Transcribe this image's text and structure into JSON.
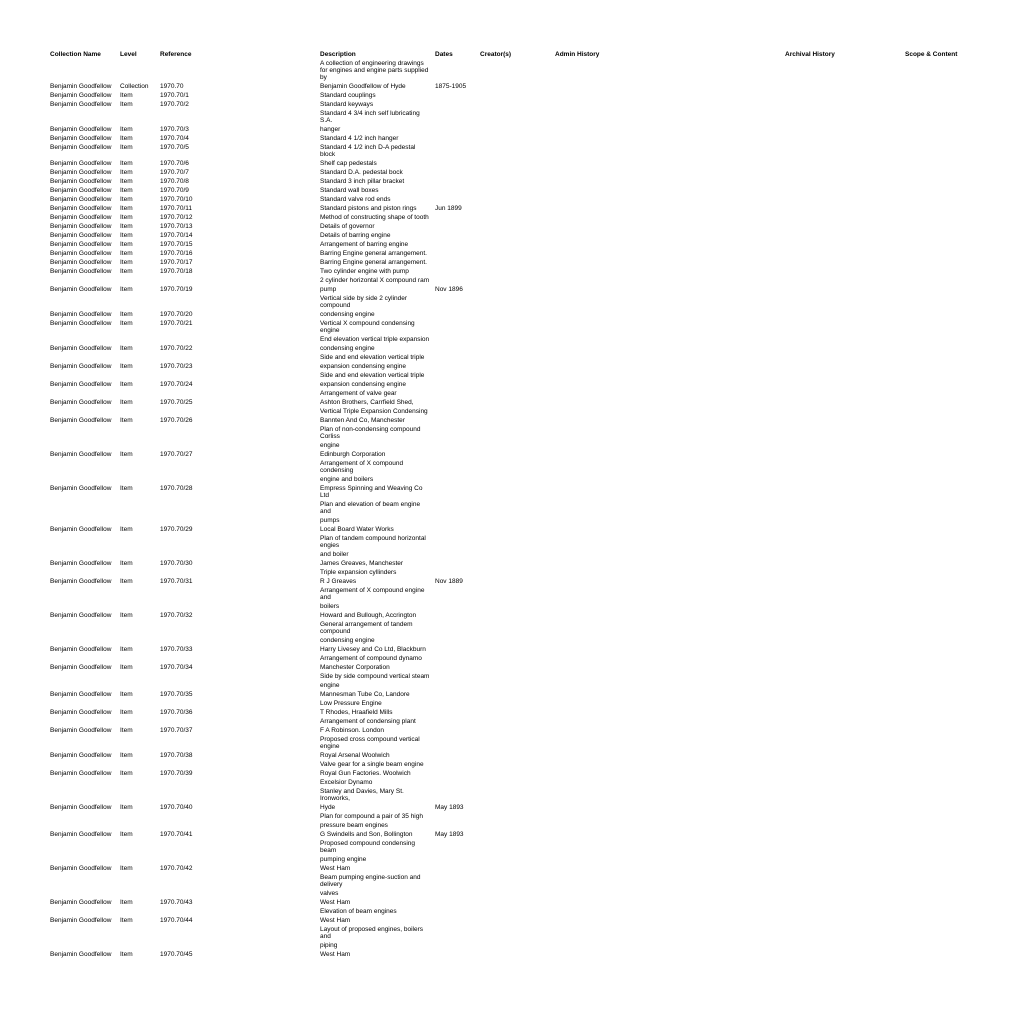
{
  "headers": {
    "collection": "Collection Name",
    "level": "Level",
    "reference": "Reference",
    "description": "Description",
    "dates": "Dates",
    "creator": "Creator(s)",
    "admin": "Admin History",
    "archival": "Archival History",
    "scope": "Scope & Content"
  },
  "rows": [
    {
      "collection": "",
      "level": "",
      "reference": "",
      "description": "A collection of engineering drawings for engines and engine parts supplied by",
      "dates": "",
      "creator": ""
    },
    {
      "collection": "Benjamin Goodfellow",
      "level": "Collection",
      "reference": "1970.70",
      "description": "Benjamin Goodfellow of Hyde",
      "dates": "1875-1905",
      "creator": ""
    },
    {
      "collection": "Benjamin Goodfellow",
      "level": "Item",
      "reference": "1970.70/1",
      "description": "Standard couplings",
      "dates": "",
      "creator": ""
    },
    {
      "collection": "Benjamin Goodfellow",
      "level": "Item",
      "reference": "1970.70/2",
      "description": "Standard keyways",
      "dates": "",
      "creator": ""
    },
    {
      "collection": "",
      "level": "",
      "reference": "",
      "description": "Standard 4 3/4 inch self lubricating S.A.",
      "dates": "",
      "creator": ""
    },
    {
      "collection": "Benjamin Goodfellow",
      "level": "Item",
      "reference": "1970.70/3",
      "description": "hanger",
      "dates": "",
      "creator": ""
    },
    {
      "collection": "Benjamin Goodfellow",
      "level": "Item",
      "reference": "1970.70/4",
      "description": "Standard 4 1/2 inch hanger",
      "dates": "",
      "creator": ""
    },
    {
      "collection": "Benjamin Goodfellow",
      "level": "Item",
      "reference": "1970.70/5",
      "description": "Standard 4 1/2 inch D-A pedestal block",
      "dates": "",
      "creator": ""
    },
    {
      "collection": "Benjamin Goodfellow",
      "level": "Item",
      "reference": "1970.70/6",
      "description": "Shelf cap pedestals",
      "dates": "",
      "creator": ""
    },
    {
      "collection": "Benjamin Goodfellow",
      "level": "Item",
      "reference": "1970.70/7",
      "description": "Standard D.A. pedestal bock",
      "dates": "",
      "creator": ""
    },
    {
      "collection": "Benjamin Goodfellow",
      "level": "Item",
      "reference": "1970.70/8",
      "description": "Standard 3 inch pillar bracket",
      "dates": "",
      "creator": ""
    },
    {
      "collection": "Benjamin Goodfellow",
      "level": "Item",
      "reference": "1970.70/9",
      "description": "Standard wall boxes",
      "dates": "",
      "creator": ""
    },
    {
      "collection": "Benjamin Goodfellow",
      "level": "Item",
      "reference": "1970.70/10",
      "description": "Standard valve rod ends",
      "dates": "",
      "creator": ""
    },
    {
      "collection": "Benjamin Goodfellow",
      "level": "Item",
      "reference": "1970.70/11",
      "description": "Standard pistons and piston rings",
      "dates": "Jun 1899",
      "creator": ""
    },
    {
      "collection": "Benjamin Goodfellow",
      "level": "Item",
      "reference": "1970.70/12",
      "description": "Method of constructing shape of tooth",
      "dates": "",
      "creator": ""
    },
    {
      "collection": "Benjamin Goodfellow",
      "level": "Item",
      "reference": "1970.70/13",
      "description": "Details of governor",
      "dates": "",
      "creator": ""
    },
    {
      "collection": "Benjamin Goodfellow",
      "level": "Item",
      "reference": "1970.70/14",
      "description": "Details of barring engine",
      "dates": "",
      "creator": ""
    },
    {
      "collection": "Benjamin Goodfellow",
      "level": "Item",
      "reference": "1970.70/15",
      "description": "Arrangement of barring engine",
      "dates": "",
      "creator": ""
    },
    {
      "collection": "Benjamin Goodfellow",
      "level": "Item",
      "reference": "1970.70/16",
      "description": "Barring Engine general arrangement.",
      "dates": "",
      "creator": ""
    },
    {
      "collection": "Benjamin Goodfellow",
      "level": "Item",
      "reference": "1970.70/17",
      "description": "Barring Engine general arrangement.",
      "dates": "",
      "creator": ""
    },
    {
      "collection": "Benjamin Goodfellow",
      "level": "Item",
      "reference": "1970.70/18",
      "description": "Two cylinder engine with pump",
      "dates": "",
      "creator": ""
    },
    {
      "collection": "",
      "level": "",
      "reference": "",
      "description": "2 cylinder horizontal X compound ram",
      "dates": "",
      "creator": ""
    },
    {
      "collection": "Benjamin Goodfellow",
      "level": "Item",
      "reference": "1970.70/19",
      "description": "pump",
      "dates": "Nov 1896",
      "creator": ""
    },
    {
      "collection": "",
      "level": "",
      "reference": "",
      "description": "Vertical side by side 2 cylinder compound",
      "dates": "",
      "creator": ""
    },
    {
      "collection": "Benjamin Goodfellow",
      "level": "Item",
      "reference": "1970.70/20",
      "description": "condensing engine",
      "dates": "",
      "creator": ""
    },
    {
      "collection": "Benjamin Goodfellow",
      "level": "Item",
      "reference": "1970.70/21",
      "description": "Vertical X compound condensing engine",
      "dates": "",
      "creator": ""
    },
    {
      "collection": "",
      "level": "",
      "reference": "",
      "description": "End elevation vertical triple expansion",
      "dates": "",
      "creator": ""
    },
    {
      "collection": "Benjamin Goodfellow",
      "level": "Item",
      "reference": "1970.70/22",
      "description": "condensing engine",
      "dates": "",
      "creator": ""
    },
    {
      "collection": "",
      "level": "",
      "reference": "",
      "description": "Side and end elevation vertical triple",
      "dates": "",
      "creator": ""
    },
    {
      "collection": "Benjamin Goodfellow",
      "level": "Item",
      "reference": "1970.70/23",
      "description": "expansion condensing engine",
      "dates": "",
      "creator": ""
    },
    {
      "collection": "",
      "level": "",
      "reference": "",
      "description": "Side and end elevation vertical triple",
      "dates": "",
      "creator": ""
    },
    {
      "collection": "Benjamin Goodfellow",
      "level": "Item",
      "reference": "1970.70/24",
      "description": "expansion condensing engine",
      "dates": "",
      "creator": ""
    },
    {
      "collection": "",
      "level": "",
      "reference": "",
      "description": "Arrangement of valve gear",
      "dates": "",
      "creator": ""
    },
    {
      "collection": "Benjamin Goodfellow",
      "level": "Item",
      "reference": "1970.70/25",
      "description": "Ashton Brothers, Carrfield Shed,",
      "dates": "",
      "creator": ""
    },
    {
      "collection": "",
      "level": "",
      "reference": "",
      "description": "Vertical Triple Expansion Condensing",
      "dates": "",
      "creator": ""
    },
    {
      "collection": "Benjamin Goodfellow",
      "level": "Item",
      "reference": "1970.70/26",
      "description": "Bannten And Co, Manchester",
      "dates": "",
      "creator": ""
    },
    {
      "collection": "",
      "level": "",
      "reference": "",
      "description": "Plan of non-condensing compound Corliss",
      "dates": "",
      "creator": ""
    },
    {
      "collection": "",
      "level": "",
      "reference": "",
      "description": "engine",
      "dates": "",
      "creator": ""
    },
    {
      "collection": "Benjamin Goodfellow",
      "level": "Item",
      "reference": "1970.70/27",
      "description": "Edinburgh Corporation",
      "dates": "",
      "creator": ""
    },
    {
      "collection": "",
      "level": "",
      "reference": "",
      "description": "Arrangement of X compound condensing",
      "dates": "",
      "creator": ""
    },
    {
      "collection": "",
      "level": "",
      "reference": "",
      "description": "engine and boilers",
      "dates": "",
      "creator": ""
    },
    {
      "collection": "Benjamin Goodfellow",
      "level": "Item",
      "reference": "1970.70/28",
      "description": "Empress Spinning and Weaving Co Ltd",
      "dates": "",
      "creator": ""
    },
    {
      "collection": "",
      "level": "",
      "reference": "",
      "description": "Plan and elevation of beam engine and",
      "dates": "",
      "creator": ""
    },
    {
      "collection": "",
      "level": "",
      "reference": "",
      "description": "pumps",
      "dates": "",
      "creator": ""
    },
    {
      "collection": "Benjamin Goodfellow",
      "level": "Item",
      "reference": "1970.70/29",
      "description": "Local Board Water Works",
      "dates": "",
      "creator": ""
    },
    {
      "collection": "",
      "level": "",
      "reference": "",
      "description": "Plan of tandem compound horizontal engies",
      "dates": "",
      "creator": ""
    },
    {
      "collection": "",
      "level": "",
      "reference": "",
      "description": "and boiler",
      "dates": "",
      "creator": ""
    },
    {
      "collection": "Benjamin Goodfellow",
      "level": "Item",
      "reference": "1970.70/30",
      "description": "James Greaves, Manchester",
      "dates": "",
      "creator": ""
    },
    {
      "collection": "",
      "level": "",
      "reference": "",
      "description": "Triple expansion cyllinders",
      "dates": "",
      "creator": ""
    },
    {
      "collection": "Benjamin Goodfellow",
      "level": "Item",
      "reference": "1970.70/31",
      "description": "R J Greaves",
      "dates": "Nov 1889",
      "creator": ""
    },
    {
      "collection": "",
      "level": "",
      "reference": "",
      "description": "Arrangement of X compound engine and",
      "dates": "",
      "creator": ""
    },
    {
      "collection": "",
      "level": "",
      "reference": "",
      "description": "boilers",
      "dates": "",
      "creator": ""
    },
    {
      "collection": "Benjamin Goodfellow",
      "level": "Item",
      "reference": "1970.70/32",
      "description": "Howard and Bullough, Accrington",
      "dates": "",
      "creator": ""
    },
    {
      "collection": "",
      "level": "",
      "reference": "",
      "description": "General arrangement of tandem compound",
      "dates": "",
      "creator": ""
    },
    {
      "collection": "",
      "level": "",
      "reference": "",
      "description": "condensing engine",
      "dates": "",
      "creator": ""
    },
    {
      "collection": "Benjamin Goodfellow",
      "level": "Item",
      "reference": "1970.70/33",
      "description": "Harry Livesey and Co Ltd, Blackburn",
      "dates": "",
      "creator": ""
    },
    {
      "collection": "",
      "level": "",
      "reference": "",
      "description": "Arrangement of compound dynamo",
      "dates": "",
      "creator": ""
    },
    {
      "collection": "Benjamin Goodfellow",
      "level": "Item",
      "reference": "1970.70/34",
      "description": "Manchester Corporation",
      "dates": "",
      "creator": ""
    },
    {
      "collection": "",
      "level": "",
      "reference": "",
      "description": "Side by side compound vertical steam",
      "dates": "",
      "creator": ""
    },
    {
      "collection": "",
      "level": "",
      "reference": "",
      "description": "engine",
      "dates": "",
      "creator": ""
    },
    {
      "collection": "Benjamin Goodfellow",
      "level": "Item",
      "reference": "1970.70/35",
      "description": "Mannesman Tube Co, Landore",
      "dates": "",
      "creator": ""
    },
    {
      "collection": "",
      "level": "",
      "reference": "",
      "description": "Low Pressure Engine",
      "dates": "",
      "creator": ""
    },
    {
      "collection": "Benjamin Goodfellow",
      "level": "Item",
      "reference": "1970.70/36",
      "description": "T Rhodes, Hraafield Mills",
      "dates": "",
      "creator": ""
    },
    {
      "collection": "",
      "level": "",
      "reference": "",
      "description": "Arrangement of condensing plant",
      "dates": "",
      "creator": ""
    },
    {
      "collection": "Benjamin Goodfellow",
      "level": "Item",
      "reference": "1970.70/37",
      "description": "F A Robinson. London",
      "dates": "",
      "creator": ""
    },
    {
      "collection": "",
      "level": "",
      "reference": "",
      "description": "Proposed cross compound vertical engine",
      "dates": "",
      "creator": ""
    },
    {
      "collection": "Benjamin Goodfellow",
      "level": "Item",
      "reference": "1970.70/38",
      "description": "Royal Arsenal Woolwich",
      "dates": "",
      "creator": ""
    },
    {
      "collection": "",
      "level": "",
      "reference": "",
      "description": "Valve gear for a single beam engine",
      "dates": "",
      "creator": ""
    },
    {
      "collection": "Benjamin Goodfellow",
      "level": "Item",
      "reference": "1970.70/39",
      "description": "Royal Gun Factories. Woolwich",
      "dates": "",
      "creator": ""
    },
    {
      "collection": "",
      "level": "",
      "reference": "",
      "description": "Excelsior Dynamo",
      "dates": "",
      "creator": ""
    },
    {
      "collection": "",
      "level": "",
      "reference": "",
      "description": "Stanley and Davies, Mary St. Ironworks,",
      "dates": "",
      "creator": ""
    },
    {
      "collection": "Benjamin Goodfellow",
      "level": "Item",
      "reference": "1970.70/40",
      "description": "Hyde",
      "dates": "May 1893",
      "creator": ""
    },
    {
      "collection": "",
      "level": "",
      "reference": "",
      "description": "Plan for compound a pair of 35 high",
      "dates": "",
      "creator": ""
    },
    {
      "collection": "",
      "level": "",
      "reference": "",
      "description": "pressure beam engines",
      "dates": "",
      "creator": ""
    },
    {
      "collection": "Benjamin Goodfellow",
      "level": "Item",
      "reference": "1970.70/41",
      "description": "G Swindells and Son, Bollington",
      "dates": "May 1893",
      "creator": ""
    },
    {
      "collection": "",
      "level": "",
      "reference": "",
      "description": "Proposed compound condensing beam",
      "dates": "",
      "creator": ""
    },
    {
      "collection": "",
      "level": "",
      "reference": "",
      "description": "pumping engine",
      "dates": "",
      "creator": ""
    },
    {
      "collection": "Benjamin Goodfellow",
      "level": "Item",
      "reference": "1970.70/42",
      "description": "West Ham",
      "dates": "",
      "creator": ""
    },
    {
      "collection": "",
      "level": "",
      "reference": "",
      "description": "Beam pumping engine-suction and delivery",
      "dates": "",
      "creator": ""
    },
    {
      "collection": "",
      "level": "",
      "reference": "",
      "description": "valves",
      "dates": "",
      "creator": ""
    },
    {
      "collection": "Benjamin Goodfellow",
      "level": "Item",
      "reference": "1970.70/43",
      "description": "West Ham",
      "dates": "",
      "creator": ""
    },
    {
      "collection": "",
      "level": "",
      "reference": "",
      "description": "Elevation of beam engines",
      "dates": "",
      "creator": ""
    },
    {
      "collection": "Benjamin Goodfellow",
      "level": "Item",
      "reference": "1970.70/44",
      "description": "West Ham",
      "dates": "",
      "creator": ""
    },
    {
      "collection": "",
      "level": "",
      "reference": "",
      "description": "Layout of proposed engines, boilers and",
      "dates": "",
      "creator": ""
    },
    {
      "collection": "",
      "level": "",
      "reference": "",
      "description": "piping",
      "dates": "",
      "creator": ""
    },
    {
      "collection": "Benjamin Goodfellow",
      "level": "Item",
      "reference": "1970.70/45",
      "description": "West Ham",
      "dates": "",
      "creator": ""
    }
  ]
}
